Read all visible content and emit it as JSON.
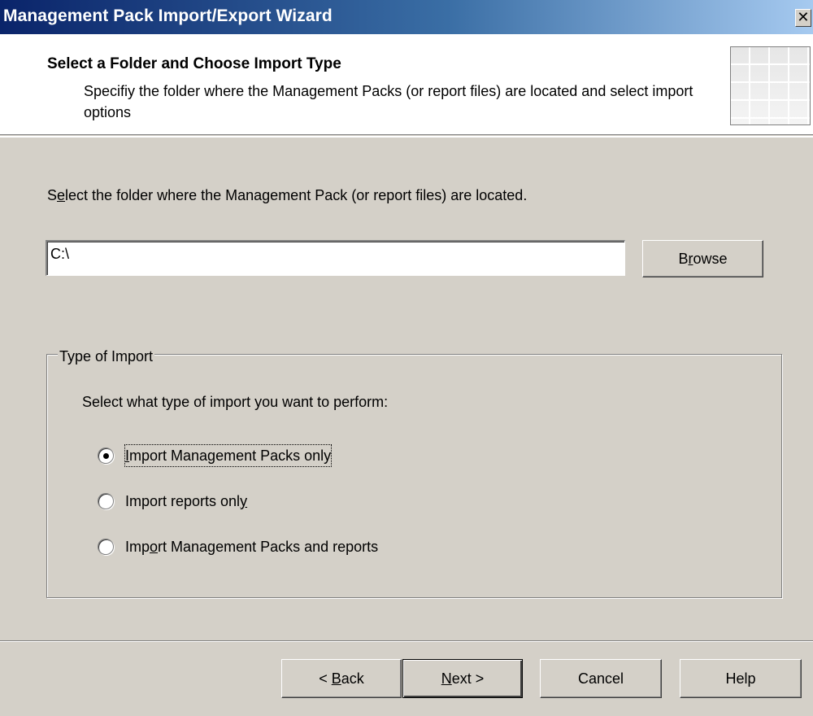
{
  "window": {
    "title": "Management Pack Import/Export Wizard",
    "close_glyph": "✕"
  },
  "header": {
    "title": "Select a Folder and Choose Import Type",
    "description": "Specifiy the folder where the Management Packs (or report files) are located and select import options",
    "graphic_icon": "wizard-banner-icon"
  },
  "folder": {
    "label_pre": "S",
    "label_accel": "e",
    "label_post": "lect the folder where the Management Pack (or report files) are located.",
    "path_value": "C:\\",
    "browse_pre": "B",
    "browse_accel": "r",
    "browse_post": "owse"
  },
  "import_type": {
    "legend": "Type of Import",
    "prompt": "Select what type of import you want to perform:",
    "options": [
      {
        "pre": "",
        "accel": "I",
        "post": "mport Management Packs only",
        "checked": true
      },
      {
        "pre": "Import reports onl",
        "accel": "y",
        "post": "",
        "checked": false
      },
      {
        "pre": "Imp",
        "accel": "o",
        "post": "rt Management Packs and reports",
        "checked": false
      }
    ]
  },
  "footer": {
    "back_pre": "< ",
    "back_accel": "B",
    "back_post": "ack",
    "next_pre": "",
    "next_accel": "N",
    "next_post": "ext >",
    "cancel": "Cancel",
    "help": "Help"
  }
}
